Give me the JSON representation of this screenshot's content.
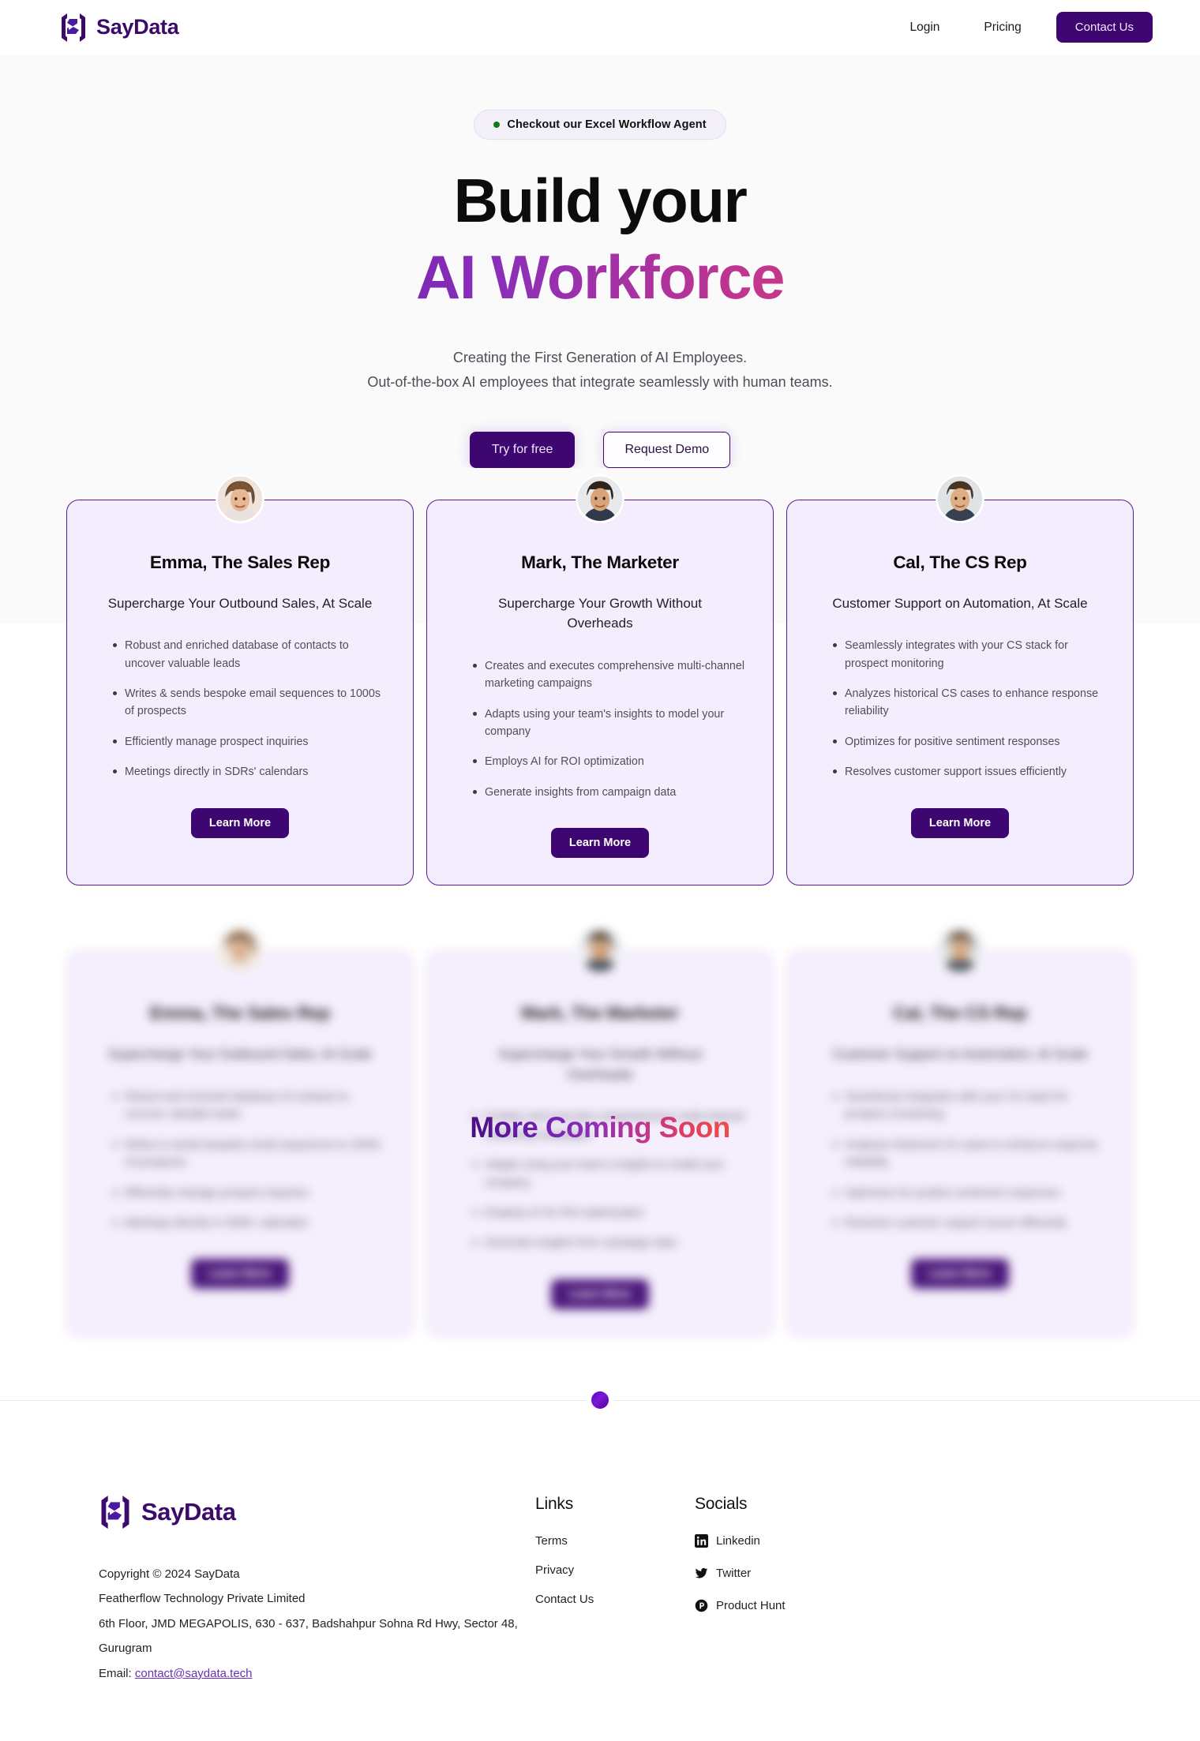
{
  "brand": {
    "name": "SayData",
    "logo_icon": "saydata-bracket-s-logo",
    "color": "#3b0a6b"
  },
  "nav": {
    "links": [
      {
        "label": "Login",
        "name": "nav-link-login"
      },
      {
        "label": "Pricing",
        "name": "nav-link-pricing"
      }
    ],
    "cta": {
      "label": "Contact Us",
      "bg": "#3d0670"
    }
  },
  "hero": {
    "badge": {
      "text": "Checkout our Excel Workflow Agent",
      "dot_color": "#0f7a1d",
      "dot_icon": "status-dot-icon"
    },
    "title_line1": "Build your",
    "title_line2": "AI Workforce",
    "title_gradient": [
      "#4a0f80",
      "#8b2fb8",
      "#c0358f",
      "#ee4444"
    ],
    "subtitle_line1": "Creating the First Generation of AI Employees.",
    "subtitle_line2": "Out-of-the-box AI employees that integrate seamlessly with human teams.",
    "primary_cta": "Try for free",
    "secondary_cta": "Request Demo"
  },
  "cards": [
    {
      "id": "emma",
      "avatar_icon": "avatar-emma",
      "title": "Emma, The Sales Rep",
      "subtitle": "Supercharge Your Outbound Sales, At Scale",
      "bullets": [
        "Robust and enriched database of contacts to uncover valuable leads",
        "Writes & sends bespoke email sequences to 1000s of prospects",
        "Efficiently manage prospect inquiries",
        "Meetings directly in SDRs' calendars"
      ],
      "cta": "Learn More"
    },
    {
      "id": "mark",
      "avatar_icon": "avatar-mark",
      "title": "Mark, The Marketer",
      "subtitle": "Supercharge Your Growth Without Overheads",
      "bullets": [
        "Creates and executes comprehensive multi-channel marketing campaigns",
        "Adapts using your team's insights to model your company",
        "Employs AI for ROI optimization",
        "Generate insights from campaign data"
      ],
      "cta": "Learn More"
    },
    {
      "id": "cal",
      "avatar_icon": "avatar-cal",
      "title": "Cal, The CS Rep",
      "subtitle": "Customer Support on Automation, At Scale",
      "bullets": [
        "Seamlessly integrates with your CS stack for prospect monitoring",
        "Analyzes historical CS cases to enhance response reliability",
        "Optimizes for positive sentiment responses",
        "Resolves customer support issues efficiently"
      ],
      "cta": "Learn More"
    }
  ],
  "coming_soon": {
    "text": "More Coming Soon"
  },
  "footer": {
    "logo_icon": "saydata-bracket-s-logo",
    "brand_name": "SayData",
    "copyright": "Copyright © 2024 SayData",
    "company": "Featherflow Technology Private Limited",
    "address": "6th Floor, JMD MEGAPOLIS, 630 - 637, Badshahpur Sohna Rd Hwy, Sector 48, Gurugram",
    "email_label": "Email:",
    "email": "contact@saydata.tech",
    "links_heading": "Links",
    "links": [
      {
        "label": "Terms",
        "name": "footer-link-terms"
      },
      {
        "label": "Privacy",
        "name": "footer-link-privacy"
      },
      {
        "label": "Contact Us",
        "name": "footer-link-contact-us"
      }
    ],
    "socials_heading": "Socials",
    "socials": [
      {
        "label": "Linkedin",
        "icon": "linkedin-icon"
      },
      {
        "label": "Twitter",
        "icon": "twitter-icon"
      },
      {
        "label": "Product Hunt",
        "icon": "product-hunt-icon"
      }
    ]
  }
}
